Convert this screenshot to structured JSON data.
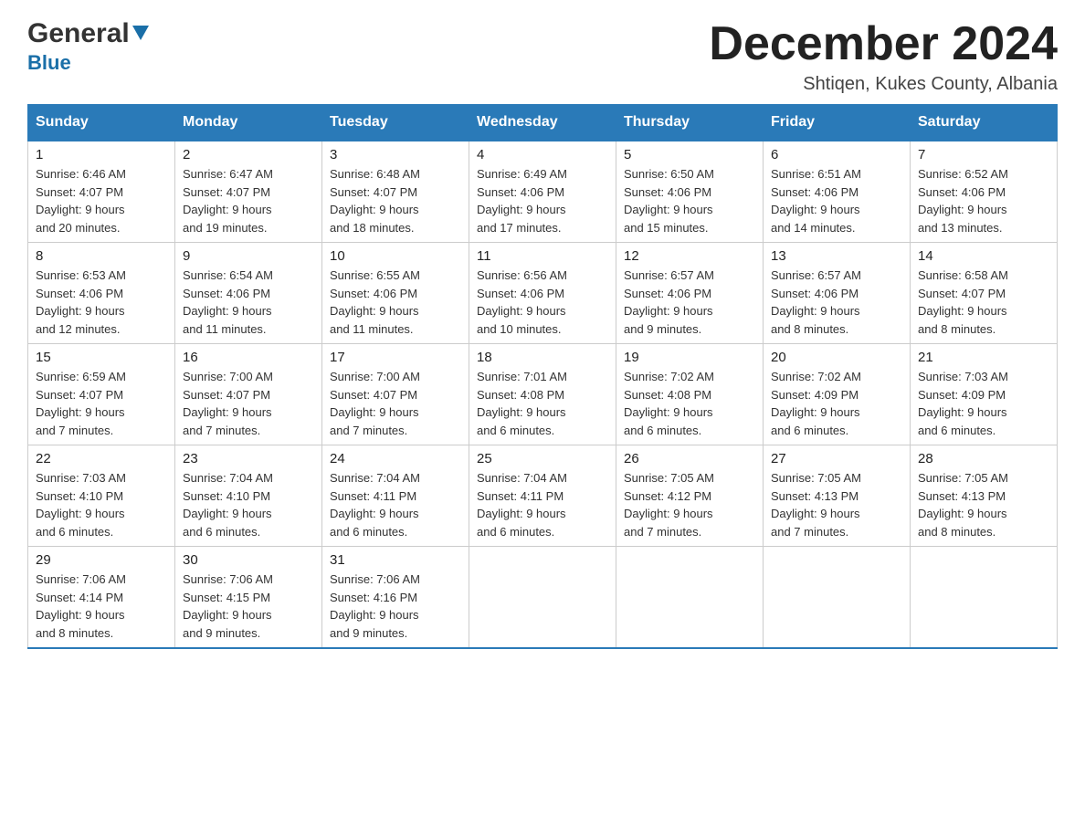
{
  "header": {
    "logo_general": "General",
    "logo_blue": "Blue",
    "title": "December 2024",
    "location": "Shtiqen, Kukes County, Albania"
  },
  "days_of_week": [
    "Sunday",
    "Monday",
    "Tuesday",
    "Wednesday",
    "Thursday",
    "Friday",
    "Saturday"
  ],
  "weeks": [
    [
      {
        "day": "1",
        "sunrise": "6:46 AM",
        "sunset": "4:07 PM",
        "daylight": "9 hours and 20 minutes."
      },
      {
        "day": "2",
        "sunrise": "6:47 AM",
        "sunset": "4:07 PM",
        "daylight": "9 hours and 19 minutes."
      },
      {
        "day": "3",
        "sunrise": "6:48 AM",
        "sunset": "4:07 PM",
        "daylight": "9 hours and 18 minutes."
      },
      {
        "day": "4",
        "sunrise": "6:49 AM",
        "sunset": "4:06 PM",
        "daylight": "9 hours and 17 minutes."
      },
      {
        "day": "5",
        "sunrise": "6:50 AM",
        "sunset": "4:06 PM",
        "daylight": "9 hours and 15 minutes."
      },
      {
        "day": "6",
        "sunrise": "6:51 AM",
        "sunset": "4:06 PM",
        "daylight": "9 hours and 14 minutes."
      },
      {
        "day": "7",
        "sunrise": "6:52 AM",
        "sunset": "4:06 PM",
        "daylight": "9 hours and 13 minutes."
      }
    ],
    [
      {
        "day": "8",
        "sunrise": "6:53 AM",
        "sunset": "4:06 PM",
        "daylight": "9 hours and 12 minutes."
      },
      {
        "day": "9",
        "sunrise": "6:54 AM",
        "sunset": "4:06 PM",
        "daylight": "9 hours and 11 minutes."
      },
      {
        "day": "10",
        "sunrise": "6:55 AM",
        "sunset": "4:06 PM",
        "daylight": "9 hours and 11 minutes."
      },
      {
        "day": "11",
        "sunrise": "6:56 AM",
        "sunset": "4:06 PM",
        "daylight": "9 hours and 10 minutes."
      },
      {
        "day": "12",
        "sunrise": "6:57 AM",
        "sunset": "4:06 PM",
        "daylight": "9 hours and 9 minutes."
      },
      {
        "day": "13",
        "sunrise": "6:57 AM",
        "sunset": "4:06 PM",
        "daylight": "9 hours and 8 minutes."
      },
      {
        "day": "14",
        "sunrise": "6:58 AM",
        "sunset": "4:07 PM",
        "daylight": "9 hours and 8 minutes."
      }
    ],
    [
      {
        "day": "15",
        "sunrise": "6:59 AM",
        "sunset": "4:07 PM",
        "daylight": "9 hours and 7 minutes."
      },
      {
        "day": "16",
        "sunrise": "7:00 AM",
        "sunset": "4:07 PM",
        "daylight": "9 hours and 7 minutes."
      },
      {
        "day": "17",
        "sunrise": "7:00 AM",
        "sunset": "4:07 PM",
        "daylight": "9 hours and 7 minutes."
      },
      {
        "day": "18",
        "sunrise": "7:01 AM",
        "sunset": "4:08 PM",
        "daylight": "9 hours and 6 minutes."
      },
      {
        "day": "19",
        "sunrise": "7:02 AM",
        "sunset": "4:08 PM",
        "daylight": "9 hours and 6 minutes."
      },
      {
        "day": "20",
        "sunrise": "7:02 AM",
        "sunset": "4:09 PM",
        "daylight": "9 hours and 6 minutes."
      },
      {
        "day": "21",
        "sunrise": "7:03 AM",
        "sunset": "4:09 PM",
        "daylight": "9 hours and 6 minutes."
      }
    ],
    [
      {
        "day": "22",
        "sunrise": "7:03 AM",
        "sunset": "4:10 PM",
        "daylight": "9 hours and 6 minutes."
      },
      {
        "day": "23",
        "sunrise": "7:04 AM",
        "sunset": "4:10 PM",
        "daylight": "9 hours and 6 minutes."
      },
      {
        "day": "24",
        "sunrise": "7:04 AM",
        "sunset": "4:11 PM",
        "daylight": "9 hours and 6 minutes."
      },
      {
        "day": "25",
        "sunrise": "7:04 AM",
        "sunset": "4:11 PM",
        "daylight": "9 hours and 6 minutes."
      },
      {
        "day": "26",
        "sunrise": "7:05 AM",
        "sunset": "4:12 PM",
        "daylight": "9 hours and 7 minutes."
      },
      {
        "day": "27",
        "sunrise": "7:05 AM",
        "sunset": "4:13 PM",
        "daylight": "9 hours and 7 minutes."
      },
      {
        "day": "28",
        "sunrise": "7:05 AM",
        "sunset": "4:13 PM",
        "daylight": "9 hours and 8 minutes."
      }
    ],
    [
      {
        "day": "29",
        "sunrise": "7:06 AM",
        "sunset": "4:14 PM",
        "daylight": "9 hours and 8 minutes."
      },
      {
        "day": "30",
        "sunrise": "7:06 AM",
        "sunset": "4:15 PM",
        "daylight": "9 hours and 9 minutes."
      },
      {
        "day": "31",
        "sunrise": "7:06 AM",
        "sunset": "4:16 PM",
        "daylight": "9 hours and 9 minutes."
      },
      null,
      null,
      null,
      null
    ]
  ],
  "labels": {
    "sunrise": "Sunrise:",
    "sunset": "Sunset:",
    "daylight": "Daylight:"
  }
}
